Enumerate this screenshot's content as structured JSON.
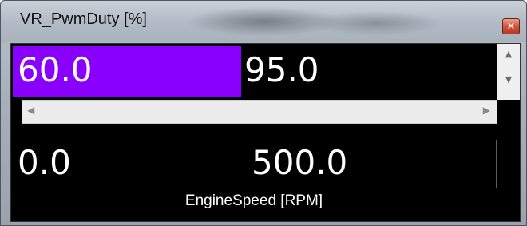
{
  "window": {
    "title": "VR_PwmDuty [%]",
    "close_glyph": "✕"
  },
  "table": {
    "output_values": [
      "60.0",
      "95.0"
    ],
    "selected_index": 0,
    "breakpoints": [
      "0.0",
      "500.0"
    ],
    "axis_label": "EngineSpeed [RPM]"
  },
  "scrollbars": {
    "up_glyph": "▲",
    "down_glyph": "▼",
    "left_glyph": "◀",
    "right_glyph": "▶"
  },
  "colors": {
    "selection": "#8a00ff",
    "cell_background": "#000000",
    "cell_text": "#ffffff"
  }
}
